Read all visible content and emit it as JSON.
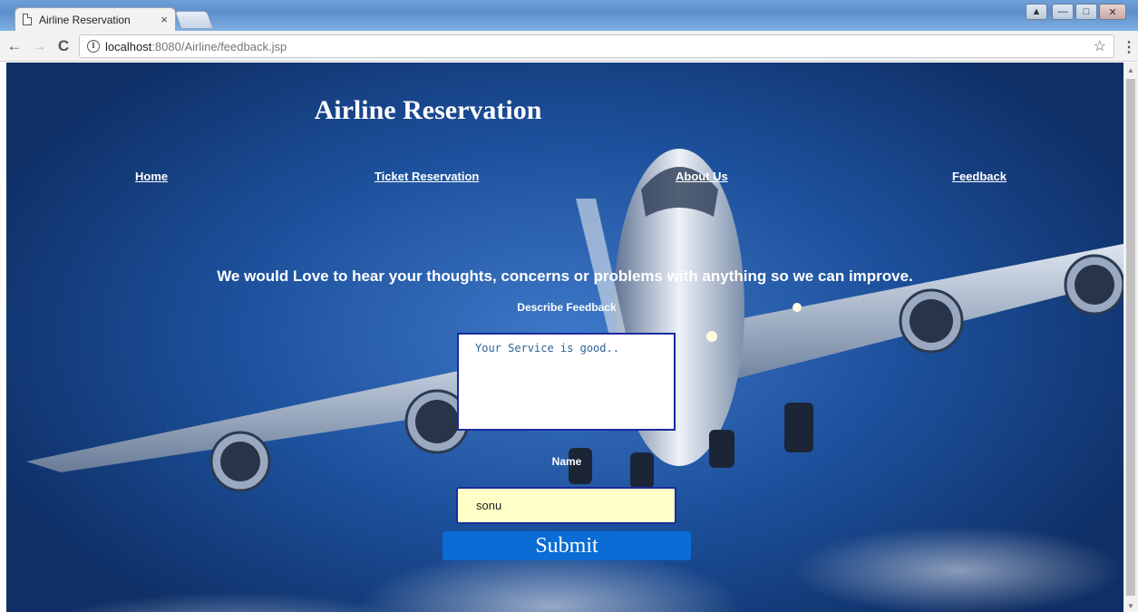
{
  "browser": {
    "tab_title": "Airline Reservation",
    "tab_close": "×",
    "url_host": "localhost",
    "url_path": ":8080/Airline/feedback.jsp",
    "star": "☆",
    "menu": "⋮"
  },
  "page": {
    "title": "Airline Reservation",
    "nav": [
      {
        "label": "Home"
      },
      {
        "label": "Ticket Reservation"
      },
      {
        "label": "About Us"
      },
      {
        "label": "Feedback"
      }
    ],
    "intro": "We would Love to hear your thoughts, concerns or problems with anything so we can improve.",
    "form": {
      "feedback_label": "Describe Feedback",
      "feedback_value": "Your Service is good..",
      "name_label": "Name",
      "name_value": "sonu",
      "submit_label": "Submit"
    }
  }
}
